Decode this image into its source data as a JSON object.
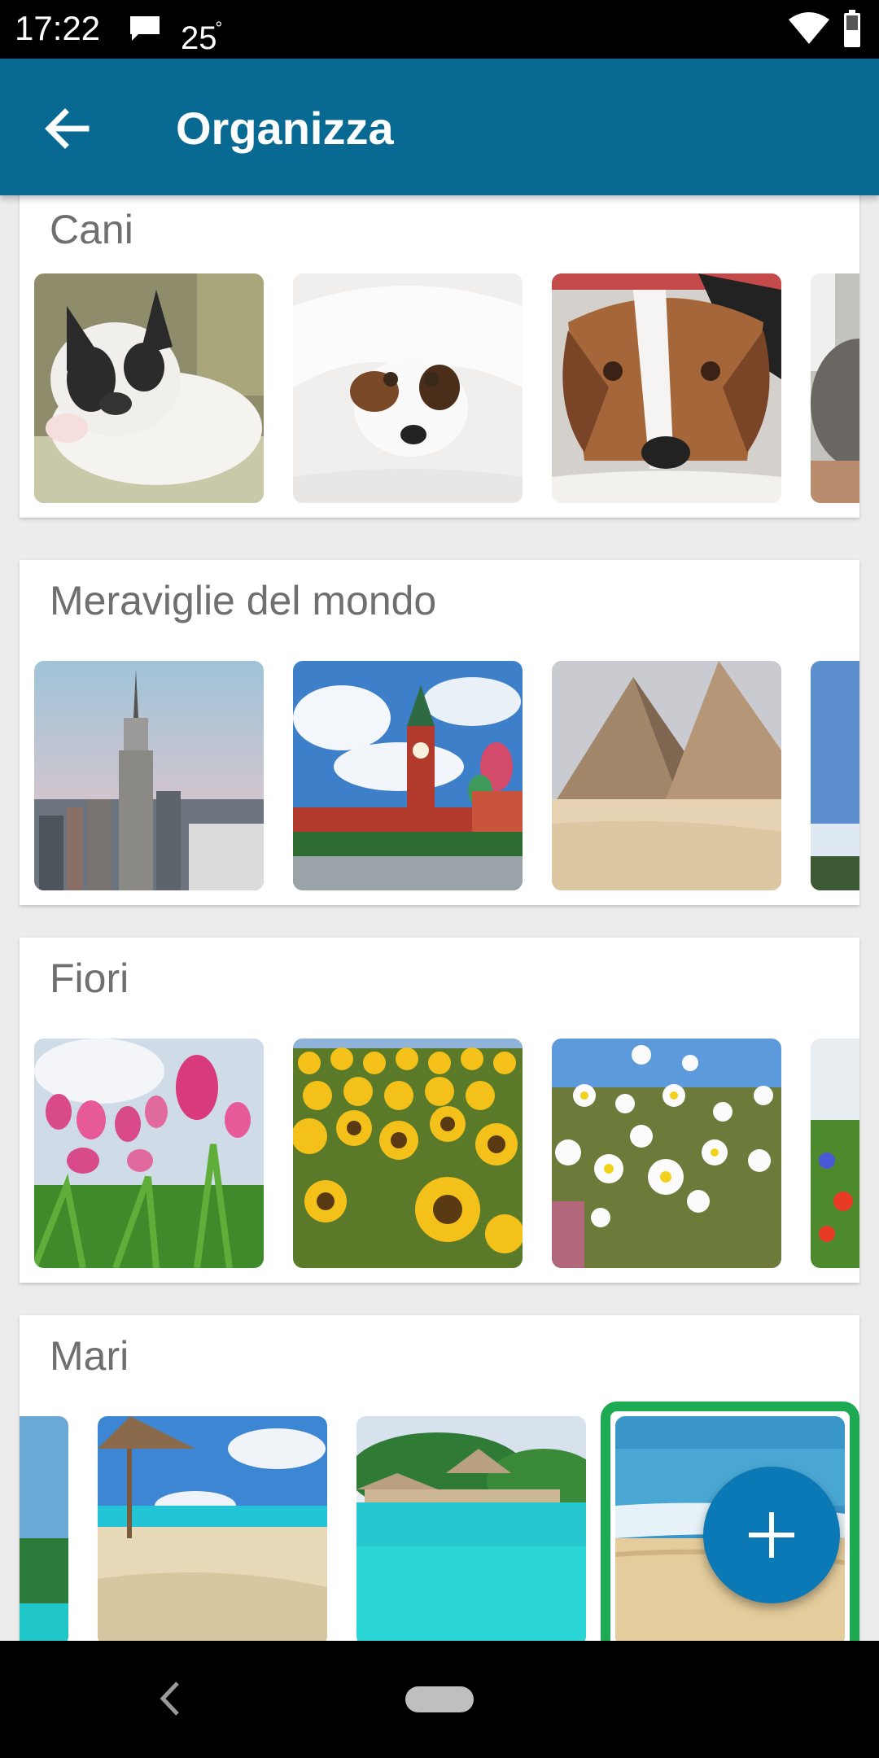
{
  "status_bar": {
    "time": "17:22",
    "temperature": "25",
    "degree": "°",
    "icons": [
      "message-icon",
      "wifi-icon",
      "battery-icon"
    ]
  },
  "app_bar": {
    "title": "Organizza",
    "back_icon": "arrow-left-icon",
    "color": "#086a93"
  },
  "categories": [
    {
      "title": "Cani",
      "images": [
        "french-bulldog-sleeping",
        "terrier-under-blanket",
        "basset-hound-lying",
        "grey-dog-partial"
      ]
    },
    {
      "title": "Meraviglie del mondo",
      "images": [
        "empire-state-building",
        "kremlin-moscow",
        "pyramids-giza",
        "sky-partial"
      ]
    },
    {
      "title": "Fiori",
      "images": [
        "pink-tulips",
        "sunflower-field",
        "white-daisies",
        "wildflowers-partial"
      ]
    },
    {
      "title": "Mari",
      "images": [
        "beach-partial",
        "beach-umbrella",
        "tropical-resort",
        "sea-beach-selected"
      ],
      "selected_index": 3
    }
  ],
  "fab": {
    "icon": "plus-icon",
    "color": "#0b79b5"
  },
  "selection_color": "#1daa53",
  "nav_bar": {
    "icons": [
      "nav-back-icon",
      "nav-home-pill"
    ]
  }
}
